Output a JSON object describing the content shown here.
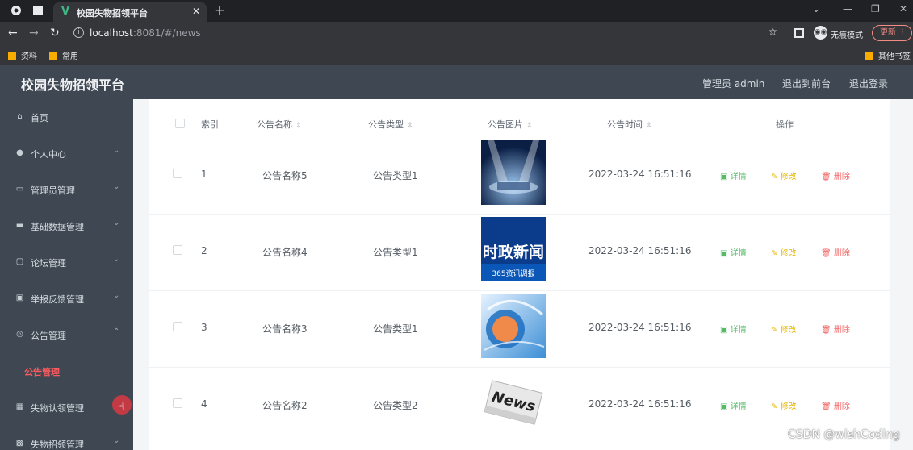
{
  "browser": {
    "tab_title": "校园失物招领平台",
    "url_host": "localhost",
    "url_rest": ":8081/#/news",
    "incognito_label": "无痕模式",
    "update_label": "更新",
    "bookmarks": [
      "资料",
      "常用"
    ],
    "other_bookmarks": "其他书签"
  },
  "header": {
    "title": "校园失物招领平台",
    "admin_label": "管理员 admin",
    "to_front": "退出到前台",
    "logout": "退出登录"
  },
  "sidebar": {
    "items": [
      {
        "label": "首页",
        "icon": "home-icon",
        "expand": false
      },
      {
        "label": "个人中心",
        "icon": "user-icon",
        "expand": true
      },
      {
        "label": "管理员管理",
        "icon": "message-icon",
        "expand": true
      },
      {
        "label": "基础数据管理",
        "icon": "data-icon",
        "expand": true
      },
      {
        "label": "论坛管理",
        "icon": "forum-icon",
        "expand": true
      },
      {
        "label": "举报反馈管理",
        "icon": "report-icon",
        "expand": true
      },
      {
        "label": "公告管理",
        "icon": "notice-icon",
        "expand": true,
        "open": true
      },
      {
        "label": "公告管理",
        "sub": true,
        "active": true
      },
      {
        "label": "失物认领管理",
        "icon": "claim-icon",
        "expand": false
      },
      {
        "label": "失物招领管理",
        "icon": "lost-icon",
        "expand": true
      }
    ]
  },
  "table": {
    "columns": [
      "索引",
      "公告名称",
      "公告类型",
      "公告图片",
      "公告时间",
      "操作"
    ],
    "rows": [
      {
        "index": "1",
        "name": "公告名称5",
        "type": "公告类型1",
        "time": "2022-03-24 16:51:16",
        "image": "stage-spotlight"
      },
      {
        "index": "2",
        "name": "公告名称4",
        "type": "公告类型1",
        "time": "2022-03-24 16:51:16",
        "image": "current-affairs-news",
        "image_text": "时政新闻",
        "image_subtext": "365资讯调报"
      },
      {
        "index": "3",
        "name": "公告名称3",
        "type": "公告类型1",
        "time": "2022-03-24 16:51:16",
        "image": "news-globe"
      },
      {
        "index": "4",
        "name": "公告名称2",
        "type": "公告类型2",
        "time": "2022-03-24 16:51:16",
        "image": "news-paper",
        "image_text": "News"
      }
    ],
    "actions": {
      "detail": "详情",
      "edit": "修改",
      "delete": "删除"
    }
  },
  "watermark": "CSDN @wishCoding",
  "colors": {
    "sidebar_bg": "#3f4852",
    "active_menu": "#ff5a5f",
    "detail": "#56b968",
    "edit": "#e6b800",
    "delete": "#f25c5c"
  }
}
